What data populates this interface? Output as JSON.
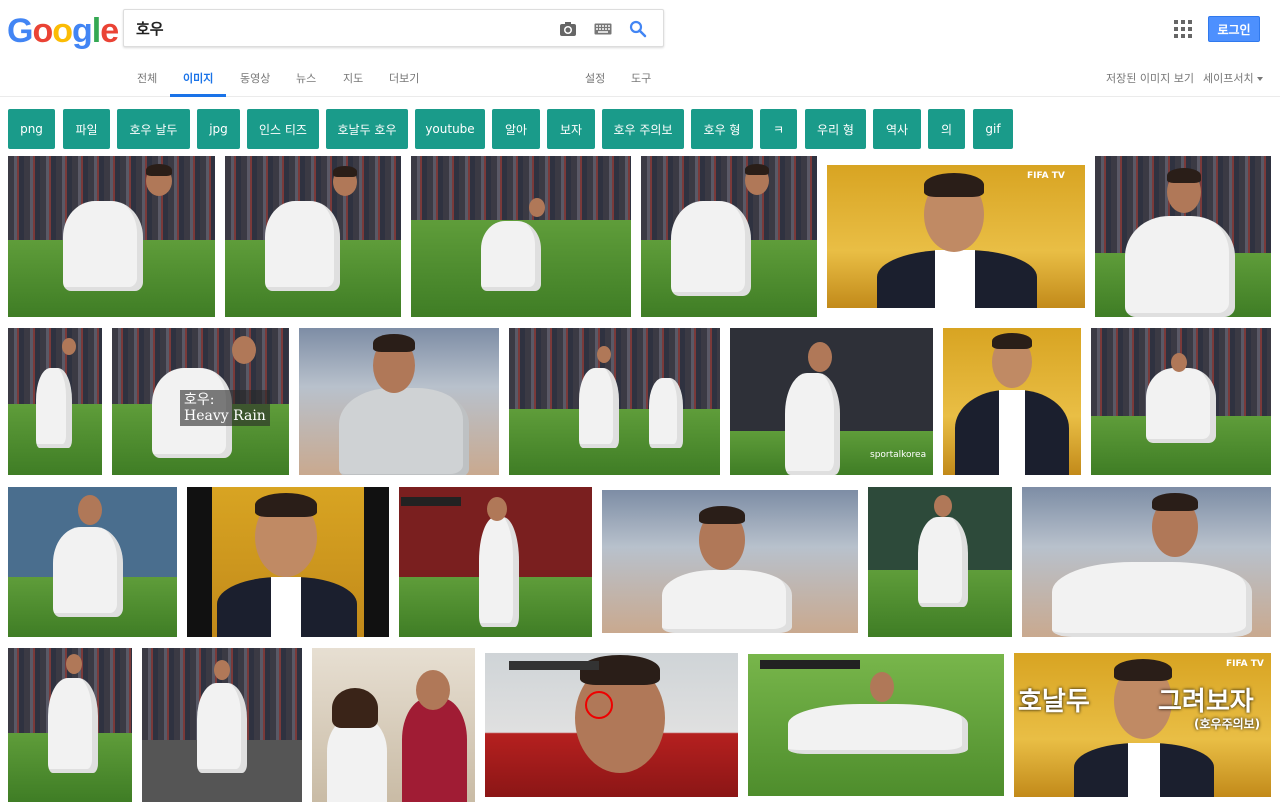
{
  "logo": {
    "letters": [
      "G",
      "o",
      "o",
      "g",
      "l",
      "e"
    ]
  },
  "search": {
    "query": "호우"
  },
  "icons": {
    "camera": "camera-icon",
    "keyboard": "keyboard-icon",
    "search": "search-icon",
    "apps": "apps-grid-icon"
  },
  "header": {
    "login_label": "로그인"
  },
  "tabs": {
    "items": [
      "전체",
      "이미지",
      "동영상",
      "뉴스",
      "지도",
      "더보기"
    ],
    "active_index": 1,
    "settings": "설정",
    "tools": "도구",
    "saved_images": "저장된 이미지 보기",
    "safe_search": "세이프서치"
  },
  "chips": [
    "png",
    "파일",
    "호우 날두",
    "jpg",
    "인스 티즈",
    "호날두 호우",
    "youtube",
    "알아",
    "보자",
    "호우 주의보",
    "호우 형",
    "ㅋ",
    "우리 형",
    "역사",
    "의",
    "gif"
  ],
  "overlays": {
    "heavy_rain": "호우:\nHeavy Rain",
    "fifa_tv_1": "FIFA TV",
    "fifa_tv_2": "FIFA TV",
    "sportalkorea": "sportalkorea",
    "banner_left": "호날두",
    "banner_right": "그려보자",
    "banner_sub": "(호우주의보)"
  },
  "colors": {
    "chip_bg": "#1a9b8a",
    "accent": "#1a73e8",
    "login_bg": "#4d90fe"
  }
}
